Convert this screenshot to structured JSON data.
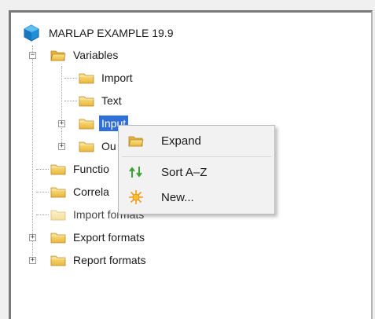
{
  "tree": {
    "root": {
      "label": "MARLAP EXAMPLE 19.9",
      "icon": "blue-gem-icon"
    },
    "variables": {
      "label": "Variables"
    },
    "variables_children": [
      {
        "label": "Import"
      },
      {
        "label": "Text"
      },
      {
        "label": "Input"
      },
      {
        "label": "Ou"
      }
    ],
    "functions": {
      "label": "Functio"
    },
    "correlations": {
      "label": "Correla"
    },
    "import_formats": {
      "label": "Import formats"
    },
    "export_formats": {
      "label": "Export formats"
    },
    "report_formats": {
      "label": "Report formats"
    }
  },
  "context_menu": {
    "expand": {
      "label": "Expand",
      "icon": "open-folder-icon"
    },
    "sort": {
      "label": "Sort A–Z",
      "icon": "sort-arrows-icon"
    },
    "new": {
      "label": "New...",
      "icon": "new-star-icon"
    }
  },
  "colors": {
    "selection": "#2f6fd6",
    "folder_fill": "#f3c843",
    "folder_edge": "#c8962a",
    "gem": "#1f8fd8"
  }
}
